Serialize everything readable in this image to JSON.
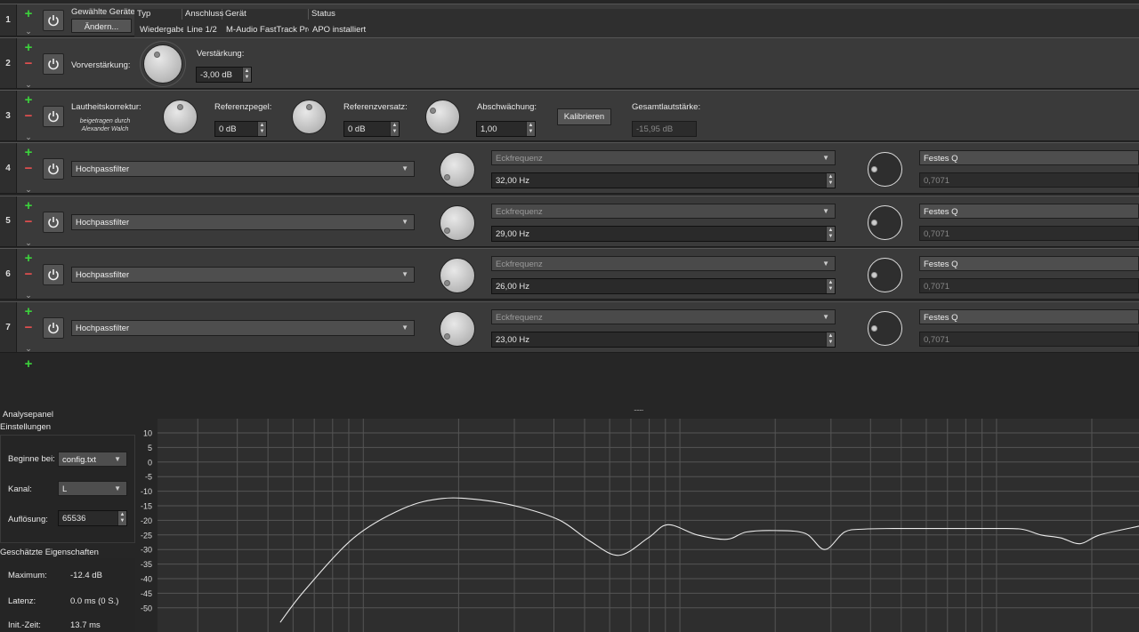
{
  "device_row": {
    "num": "1",
    "label": "Gewählte Geräte:",
    "change_button": "Ändern...",
    "columns": [
      "Typ",
      "Anschluss",
      "Gerät",
      "Status"
    ],
    "values": [
      "Wiedergabe",
      "Line 1/2",
      "M-Audio FastTrack Pro",
      "APO installiert"
    ]
  },
  "preamp_row": {
    "num": "2",
    "label": "Vorverstärkung:",
    "gain_label": "Verstärkung:",
    "gain_value": "-3,00 dB"
  },
  "loudness_row": {
    "num": "3",
    "label": "Lautheitskorrektur:",
    "credit": "beigetragen durch\nAlexander Walch",
    "ref_level_label": "Referenzpegel:",
    "ref_level_value": "0 dB",
    "ref_offset_label": "Referenzversatz:",
    "ref_offset_value": "0 dB",
    "attenuation_label": "Abschwächung:",
    "attenuation_value": "1,00",
    "calibrate_button": "Kalibrieren",
    "total_loudness_label": "Gesamtlautstärke:",
    "total_loudness_value": "-15,95 dB"
  },
  "filter_rows": [
    {
      "num": "4",
      "type": "Hochpassfilter",
      "freq_mode": "Eckfrequenz",
      "freq_value": "32,00 Hz",
      "q_mode": "Festes Q",
      "q_value": "0,7071"
    },
    {
      "num": "5",
      "type": "Hochpassfilter",
      "freq_mode": "Eckfrequenz",
      "freq_value": "29,00 Hz",
      "q_mode": "Festes Q",
      "q_value": "0,7071"
    },
    {
      "num": "6",
      "type": "Hochpassfilter",
      "freq_mode": "Eckfrequenz",
      "freq_value": "26,00 Hz",
      "q_mode": "Festes Q",
      "q_value": "0,7071"
    },
    {
      "num": "7",
      "type": "Hochpassfilter",
      "freq_mode": "Eckfrequenz",
      "freq_value": "23,00 Hz",
      "q_mode": "Festes Q",
      "q_value": "0,7071"
    }
  ],
  "analysis": {
    "panel_title": "Analysepanel",
    "settings_title": "Einstellungen",
    "start_label": "Beginne bei:",
    "start_value": "config.txt",
    "channel_label": "Kanal:",
    "channel_value": "L",
    "resolution_label": "Auflösung:",
    "resolution_value": "65536",
    "props_title": "Geschätzte Eigenschaften",
    "max_label": "Maximum:",
    "max_value": "-12.4 dB",
    "latency_label": "Latenz:",
    "latency_value": "0.0 ms (0 S.)",
    "init_label": "Init.-Zeit:",
    "init_value": "13.7 ms"
  },
  "chart_data": {
    "type": "line",
    "y_ticks": [
      "10",
      "5",
      "0",
      "-5",
      "-10",
      "-15",
      "-20",
      "-25",
      "-30",
      "-35",
      "-40",
      "-45",
      "-50"
    ],
    "ylim": [
      -50,
      10
    ],
    "x_scale": "log",
    "grid": true,
    "series": [
      {
        "x": [
          0.125,
          0.15,
          0.2,
          0.25,
          0.29,
          0.33,
          0.37,
          0.41,
          0.44,
          0.47,
          0.5,
          0.52,
          0.55,
          0.58,
          0.6,
          0.63,
          0.66,
          0.68,
          0.7,
          0.72,
          0.75,
          0.8,
          0.85,
          0.88,
          0.9,
          0.92,
          0.94,
          0.96,
          1.0
        ],
        "values": [
          -55,
          -44,
          -26,
          -16,
          -12.5,
          -13,
          -15.5,
          -20,
          -27,
          -32,
          -26,
          -21.5,
          -25,
          -26.5,
          -24,
          -23.5,
          -24.5,
          -30,
          -24,
          -23,
          -22.8,
          -22.8,
          -22.8,
          -23,
          -25,
          -26,
          -28,
          -25,
          -22
        ]
      }
    ]
  }
}
